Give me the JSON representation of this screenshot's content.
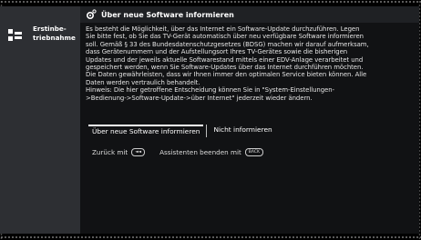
{
  "sidebar": {
    "items": [
      {
        "label": "Erstinbe-triebnahme",
        "icon": "initial-setup-icon"
      }
    ]
  },
  "dialog": {
    "title": "Über neue Software informieren",
    "title_icon": "gear-icon",
    "body": "Es besteht die Möglichkeit, über das Internet ein Software-Update durchzuführen. Legen\nSie bitte fest, ob Sie das TV-Gerät automatisch über neu verfügbare Software informieren\nsoll. Gemäß § 33 des Bundesdatenschutzgesetzes (BDSG) machen wir darauf aufmerksam,\ndass Gerätenummern und der Aufstellungsort Ihres TV-Gerätes sowie die bisherigen\nUpdates und der jeweils aktuelle Softwarestand mittels einer EDV-Anlage verarbeitet und\ngespeichert werden, wenn Sie Software-Updates über das Internet durchführen möchten.\nDie Daten gewährleisten, dass wir Ihnen immer den optimalen Service bieten können. Alle\nDaten werden vertraulich behandelt.\nHinweis: Die hier getroffene Entscheidung können Sie in \"System-Einstellungen-\n>Bedienung->Software-Update->über Internet\" jederzeit wieder ändern.",
    "buttons": [
      {
        "label": "Über neue Software informieren",
        "focused": true
      },
      {
        "label": "Nicht informieren",
        "focused": false
      }
    ]
  },
  "hints": {
    "back_label": "Zurück mit",
    "back_key": "◄◄",
    "exit_label": "Assistenten beenden mit",
    "exit_key": "BACK"
  },
  "colors": {
    "background": "#000000",
    "sidebar": "#2d2f33",
    "panel": "#111214",
    "title_bar": "#1f2124"
  }
}
